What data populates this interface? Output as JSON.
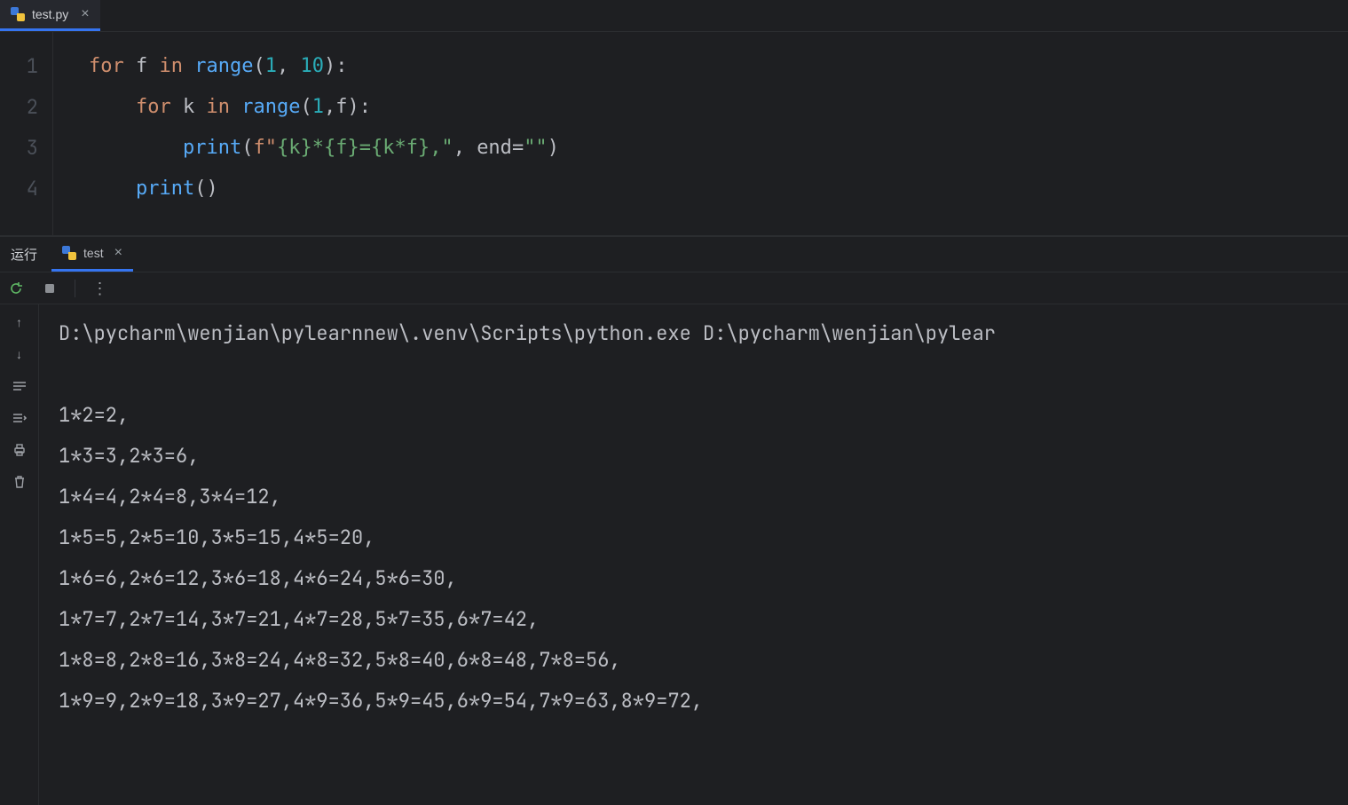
{
  "file_tab": {
    "name": "test.py",
    "icon": "python-icon",
    "close": "×"
  },
  "editor": {
    "line_numbers": [
      "1",
      "2",
      "3",
      "4"
    ],
    "code_lines": [
      [
        {
          "t": "for ",
          "c": "kw"
        },
        {
          "t": "f ",
          "c": "id"
        },
        {
          "t": "in ",
          "c": "kw"
        },
        {
          "t": "range",
          "c": "fn"
        },
        {
          "t": "(",
          "c": "punct"
        },
        {
          "t": "1",
          "c": "num"
        },
        {
          "t": ", ",
          "c": "punct"
        },
        {
          "t": "10",
          "c": "num"
        },
        {
          "t": "):",
          "c": "punct"
        }
      ],
      [
        {
          "t": "    ",
          "c": "id"
        },
        {
          "t": "for ",
          "c": "kw"
        },
        {
          "t": "k ",
          "c": "id"
        },
        {
          "t": "in ",
          "c": "kw"
        },
        {
          "t": "range",
          "c": "fn"
        },
        {
          "t": "(",
          "c": "punct"
        },
        {
          "t": "1",
          "c": "num"
        },
        {
          "t": ",",
          "c": "punct"
        },
        {
          "t": "f",
          "c": "id"
        },
        {
          "t": "):",
          "c": "punct"
        }
      ],
      [
        {
          "t": "        ",
          "c": "id"
        },
        {
          "t": "print",
          "c": "fn"
        },
        {
          "t": "(",
          "c": "punct"
        },
        {
          "t": "f\"",
          "c": "fs"
        },
        {
          "t": "{k}",
          "c": "str"
        },
        {
          "t": "*",
          "c": "str"
        },
        {
          "t": "{f}",
          "c": "str"
        },
        {
          "t": "=",
          "c": "str"
        },
        {
          "t": "{k*f}",
          "c": "str"
        },
        {
          "t": ",\"",
          "c": "str"
        },
        {
          "t": ", ",
          "c": "punct"
        },
        {
          "t": "end",
          "c": "id"
        },
        {
          "t": "=",
          "c": "punct"
        },
        {
          "t": "\"\"",
          "c": "str"
        },
        {
          "t": ")",
          "c": "punct"
        }
      ],
      [
        {
          "t": "    ",
          "c": "id"
        },
        {
          "t": "print",
          "c": "fn"
        },
        {
          "t": "()",
          "c": "punct"
        }
      ]
    ]
  },
  "run_panel": {
    "title": "运行",
    "tab_label": "test",
    "tab_icon": "python-icon",
    "tab_close": "×",
    "command_line": "D:\\pycharm\\wenjian\\pylearnnew\\.venv\\Scripts\\python.exe D:\\pycharm\\wenjian\\pylear",
    "output_lines": [
      "",
      "1*2=2,",
      "1*3=3,2*3=6,",
      "1*4=4,2*4=8,3*4=12,",
      "1*5=5,2*5=10,3*5=15,4*5=20,",
      "1*6=6,2*6=12,3*6=18,4*6=24,5*6=30,",
      "1*7=7,2*7=14,3*7=21,4*7=28,5*7=35,6*7=42,",
      "1*8=8,2*8=16,3*8=24,4*8=32,5*8=40,6*8=48,7*8=56,",
      "1*9=9,2*9=18,3*9=27,4*9=36,5*9=45,6*9=54,7*9=63,8*9=72,"
    ]
  },
  "icons": {
    "rerun": "↻",
    "stop": "■",
    "more": "⋮",
    "up": "↑",
    "down": "↓",
    "softwrap": "⇉",
    "scroll": "⇥",
    "print": "⎙",
    "trash": "🗑"
  }
}
